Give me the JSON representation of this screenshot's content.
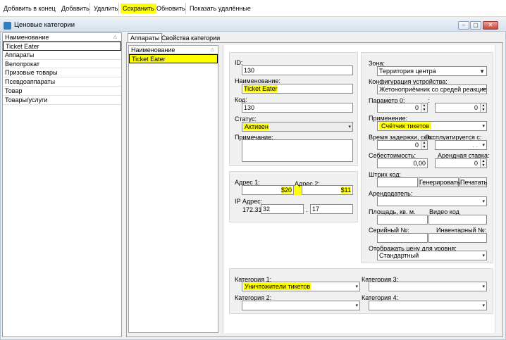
{
  "toolbar": {
    "add_to_end": "Добавить в конец",
    "add": "Добавить",
    "delete": "Удалить",
    "save": "Сохранить",
    "refresh": "Обновить",
    "show_deleted": "Показать удалённые"
  },
  "window": {
    "title": "Ценовые категории",
    "controls": [
      "–",
      "▢",
      "✕"
    ]
  },
  "categories": {
    "header": "Наименование",
    "items": [
      "Ticket Eater",
      "Аппараты",
      "Велопрокат",
      "Призовые товары",
      "Псевдоаппараты",
      "Товар",
      "Товары/услуги"
    ],
    "selected": "Ticket Eater"
  },
  "tabs": [
    "Аппараты",
    "Свойства категории"
  ],
  "devices": {
    "header": "Наименование",
    "items": [
      "Ticket Eater"
    ]
  },
  "form": {
    "id_label": "ID:",
    "id_value": "130",
    "name_label": "Наименование:",
    "name_value": "Ticket Eater",
    "code_label": "Код:",
    "code_value": "130",
    "status_label": "Статус:",
    "status_value": "Активен",
    "note_label": "Примечание:",
    "note_value": "",
    "address1_label": "Адрес 1:",
    "address1_value": "$20",
    "address2_label": "Адрес 2:",
    "address2_value": "$11",
    "ip_label": "IP Адрес:",
    "ip_prefix": "172.31",
    "ip_octet3": "32",
    "ip_sep": ".",
    "ip_octet4": "17",
    "zone_label": "Зона:",
    "zone_value": "Территория центра",
    "config_label": "Конфигурация устройства:",
    "config_value": "Жетоноприёмник со средей реакцией",
    "param0_label": "Параметр 0:",
    "param0_value": "0",
    "param0_colon": ":",
    "param1_value": "0",
    "usage_label": "Применение:",
    "usage_value": "Счётчик тикетов",
    "delay_label": "Время задержки, сек.:",
    "delay_value": "0",
    "operated_label": "Эксплуатируется с:",
    "operated_value": ". .",
    "cost_label": "Себестоимость:",
    "cost_value": "0,00",
    "rent_label": "Арендная ставка:",
    "rent_value": "0",
    "barcode_label": "Штрих код:",
    "barcode_value": "",
    "generate_button": "Генерировать",
    "print_button": "Печатать",
    "lessor_label": "Арендодатель:",
    "lessor_value": "",
    "area_label": "Площадь, кв. м.",
    "area_value": "",
    "video_label": "Видео код",
    "video_value": "",
    "serial_label": "Серийный №:",
    "serial_value": "",
    "inventory_label": "Инвентарный №:",
    "inventory_value": "",
    "price_level_label": "Отображать цену для уровня:",
    "price_level_value": "Стандартный",
    "cat1_label": "Категория 1:",
    "cat1_value": "Уничтожители тикетов",
    "cat2_label": "Категория 2:",
    "cat2_value": "",
    "cat3_label": "Категория 3:",
    "cat3_value": "",
    "cat4_label": "Категория 4:",
    "cat4_value": ""
  },
  "icons": {
    "dropdown": "chevron-down-icon",
    "sort": "sort-triangle-icon",
    "app": "window-app-icon"
  },
  "colors": {
    "highlight": "#ffff00",
    "title_icon": "#2c7fc4"
  }
}
